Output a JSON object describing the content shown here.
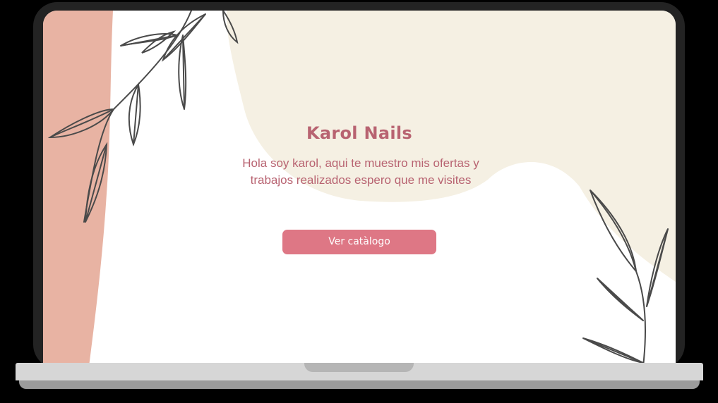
{
  "site": {
    "title": "Karol Nails",
    "intro": "Hola soy karol, aqui te muestro mis ofertas y trabajos realizados espero que me visites",
    "cta_label": "Ver catàlogo"
  },
  "colors": {
    "accent": "#de7785",
    "text": "#b86371",
    "side_band": "#e8b3a3",
    "cream_shape": "#f5f0e3",
    "leaf_line": "#4a4a4a",
    "bezel": "#232323"
  },
  "icons": {
    "left_foliage": "leaf-branch",
    "right_foliage": "leaf-branch"
  }
}
